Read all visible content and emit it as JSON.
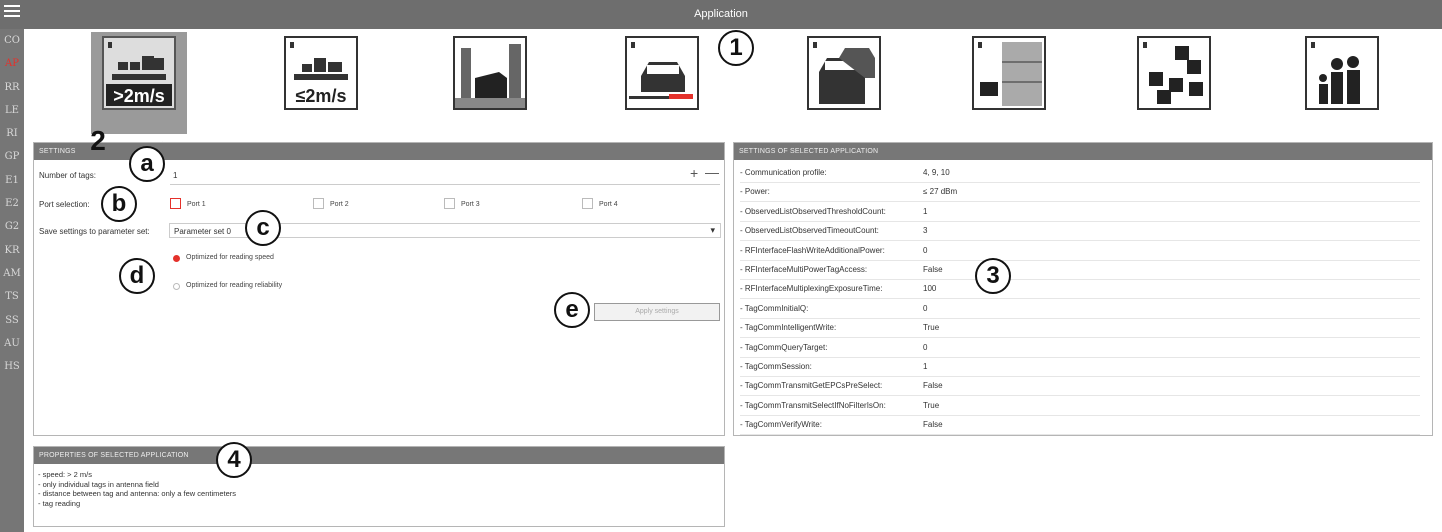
{
  "window": {
    "title": "Application"
  },
  "sidebar": {
    "items": [
      {
        "label": "CO",
        "active": false
      },
      {
        "label": "AP",
        "active": true
      },
      {
        "label": "RR",
        "active": false
      },
      {
        "label": "LE",
        "active": false
      },
      {
        "label": "RI",
        "active": false
      },
      {
        "label": "GP",
        "active": false
      },
      {
        "label": "E1",
        "active": false
      },
      {
        "label": "E2",
        "active": false
      },
      {
        "label": "G2",
        "active": false
      },
      {
        "label": "KR",
        "active": false
      },
      {
        "label": "AM",
        "active": false
      },
      {
        "label": "TS",
        "active": false
      },
      {
        "label": "SS",
        "active": false
      },
      {
        "label": "AU",
        "active": false
      },
      {
        "label": "HS",
        "active": false
      }
    ]
  },
  "applications": [
    {
      "label": "Conveyor > 2 m/s",
      "icon": "conveyor-fast-icon",
      "badge": ">2m/s",
      "selected": true
    },
    {
      "label": "Conveyor ≤ 2 m/s",
      "icon": "conveyor-slow-icon",
      "badge": "≤2m/s",
      "selected": false
    },
    {
      "label": "Gate",
      "icon": "gate-icon",
      "selected": false
    },
    {
      "label": "Vehicle barrier identification",
      "icon": "vehicle-barrier-icon",
      "selected": false
    },
    {
      "label": "Vehicle identification",
      "icon": "vehicle-identification-icon",
      "selected": false
    },
    {
      "label": "Shelf application",
      "icon": "shelf-icon",
      "selected": false
    },
    {
      "label": "Place monitoring",
      "icon": "place-monitoring-icon",
      "selected": false
    },
    {
      "label": "People identification",
      "icon": "people-identification-icon",
      "selected": false
    }
  ],
  "settings": {
    "header": "SETTINGS",
    "number_of_tags_label": "Number of tags:",
    "number_of_tags_value": "1",
    "plus": "+",
    "minus": "—",
    "port_selection_label": "Port selection:",
    "ports": [
      {
        "label": "Port 1",
        "checked": true
      },
      {
        "label": "Port 2",
        "checked": false
      },
      {
        "label": "Port 3",
        "checked": false
      },
      {
        "label": "Port 4",
        "checked": false
      }
    ],
    "save_label": "Save settings to parameter set:",
    "save_value": "Parameter set 0",
    "caret": "▾",
    "optimize_options": [
      {
        "label": "Optimized for reading speed",
        "selected": true
      },
      {
        "label": "Optimized for reading reliability",
        "selected": false
      }
    ],
    "apply_label": "Apply settings"
  },
  "selected_settings": {
    "header": "SETTINGS OF SELECTED APPLICATION",
    "rows": [
      {
        "key": "- Communication profile:",
        "value": "4, 9, 10"
      },
      {
        "key": "- Power:",
        "value": "≤ 27 dBm"
      },
      {
        "key": "- ObservedListObservedThresholdCount:",
        "value": "1"
      },
      {
        "key": "- ObservedListObservedTimeoutCount:",
        "value": "3"
      },
      {
        "key": "- RFInterfaceFlashWriteAdditionalPower:",
        "value": "0"
      },
      {
        "key": "- RFInterfaceMultiPowerTagAccess:",
        "value": "False"
      },
      {
        "key": "- RFInterfaceMultiplexingExposureTime:",
        "value": "100"
      },
      {
        "key": "- TagCommInitialQ:",
        "value": "0"
      },
      {
        "key": "- TagCommIntelligentWrite:",
        "value": "True"
      },
      {
        "key": "- TagCommQueryTarget:",
        "value": "0"
      },
      {
        "key": "- TagCommSession:",
        "value": "1"
      },
      {
        "key": "- TagCommTransmitGetEPCsPreSelect:",
        "value": "False"
      },
      {
        "key": "- TagCommTransmitSelectIfNoFilterIsOn:",
        "value": "True"
      },
      {
        "key": "- TagCommVerifyWrite:",
        "value": "False"
      }
    ]
  },
  "properties": {
    "header": "PROPERTIES OF SELECTED APPLICATION",
    "lines": [
      "- speed: > 2 m/s",
      "- only individual tags in antenna field",
      "- distance between tag and antenna: only a few centimeters",
      "- tag reading"
    ]
  },
  "callouts": [
    "1",
    "2",
    "a",
    "b",
    "c",
    "d",
    "e",
    "3",
    "4"
  ],
  "colors": {
    "accent": "#e4312b",
    "titlebar": "#6e6e6e",
    "panel_header": "#777777"
  }
}
